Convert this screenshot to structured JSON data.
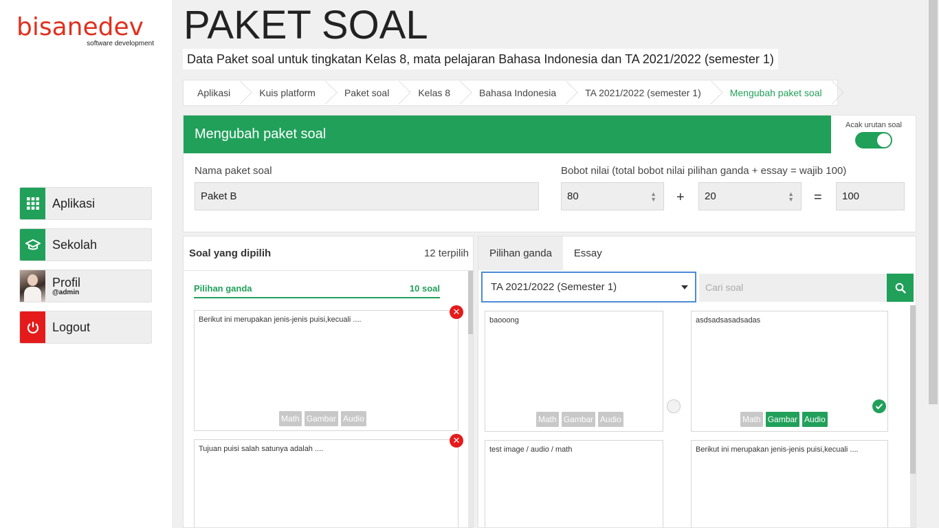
{
  "brand": {
    "name": "bisanedev",
    "tagline": "software development"
  },
  "nav": [
    {
      "label": "Aplikasi",
      "icon": "grid-icon"
    },
    {
      "label": "Sekolah",
      "icon": "graduation-cap-icon"
    },
    {
      "label": "Profil",
      "sub": "@admin",
      "icon": "avatar"
    },
    {
      "label": "Logout",
      "icon": "power-icon"
    }
  ],
  "page": {
    "title": "PAKET SOAL",
    "subtitle": "Data Paket soal untuk tingkatan Kelas 8, mata pelajaran Bahasa Indonesia dan TA 2021/2022 (semester 1)"
  },
  "breadcrumb": [
    "Aplikasi",
    "Kuis platform",
    "Paket soal",
    "Kelas 8",
    "Bahasa Indonesia",
    "TA 2021/2022 (semester 1)",
    "Mengubah paket soal"
  ],
  "form": {
    "header": "Mengubah paket soal",
    "shuffle_label": "Acak urutan soal",
    "shuffle_on": true,
    "name_label": "Nama paket soal",
    "name_value": "Paket B",
    "weight_label": "Bobot nilai (total bobot nilai pilihan ganda + essay = wajib 100)",
    "weight_pg": "80",
    "plus": "+",
    "weight_essay": "20",
    "equals": "=",
    "weight_total": "100"
  },
  "selected": {
    "title": "Soal yang dipilih",
    "count": "12 terpilih",
    "section_label": "Pilihan ganda",
    "section_count": "10 soal",
    "questions": [
      {
        "text": "Berikut ini merupakan jenis-jenis puisi,kecuali ....",
        "tags": [
          "Math",
          "Gambar",
          "Audio"
        ]
      },
      {
        "text": "Tujuan puisi salah satunya adalah ...."
      }
    ]
  },
  "bank": {
    "tabs": [
      "Pilihan ganda",
      "Essay"
    ],
    "active_tab": "Pilihan ganda",
    "year_select": "TA 2021/2022 (Semester 1)",
    "search_placeholder": "Cari soal",
    "questions": [
      {
        "text": "baooong",
        "tags": [
          "Math",
          "Gambar",
          "Audio"
        ],
        "active_tags": [],
        "selected": false
      },
      {
        "text": "asdsadsasadsadas",
        "tags": [
          "Math",
          "Gambar",
          "Audio"
        ],
        "active_tags": [
          "Gambar",
          "Audio"
        ],
        "selected": true
      },
      {
        "text": "test image / audio / math"
      },
      {
        "text": "Berikut ini merupakan jenis-jenis puisi,kecuali ...."
      }
    ]
  },
  "colors": {
    "accent": "#21a05a",
    "danger": "#e51b1b",
    "brand": "#e0301e",
    "focus": "#4a8bd6"
  }
}
